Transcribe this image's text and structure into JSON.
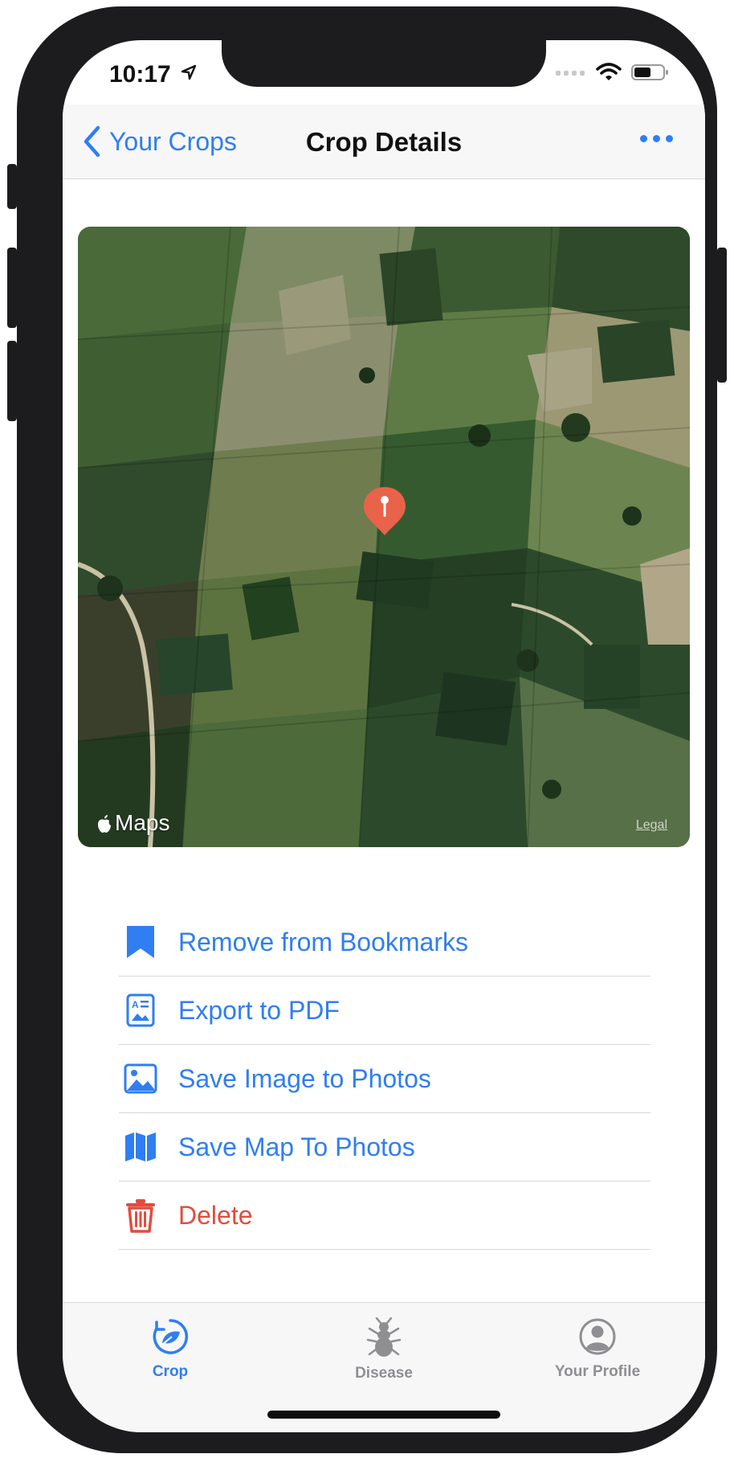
{
  "status_bar": {
    "time": "10:17"
  },
  "nav": {
    "back_label": "Your Crops",
    "title": "Crop Details"
  },
  "map": {
    "brand": "Maps",
    "legal": "Legal"
  },
  "actions": [
    {
      "label": "Remove from Bookmarks",
      "icon": "bookmark-icon"
    },
    {
      "label": "Export to PDF",
      "icon": "document-icon"
    },
    {
      "label": "Save Image to Photos",
      "icon": "photo-icon"
    },
    {
      "label": "Save Map To Photos",
      "icon": "map-icon"
    },
    {
      "label": "Delete",
      "icon": "trash-icon"
    }
  ],
  "tabs": [
    {
      "label": "Crop",
      "icon": "crop-leaf-icon",
      "active": true
    },
    {
      "label": "Disease",
      "icon": "bug-icon",
      "active": false
    },
    {
      "label": "Your Profile",
      "icon": "profile-icon",
      "active": false
    }
  ],
  "colors": {
    "accent": "#2f7ef2",
    "danger": "#e24c3f",
    "inactive": "#8e8e93"
  }
}
